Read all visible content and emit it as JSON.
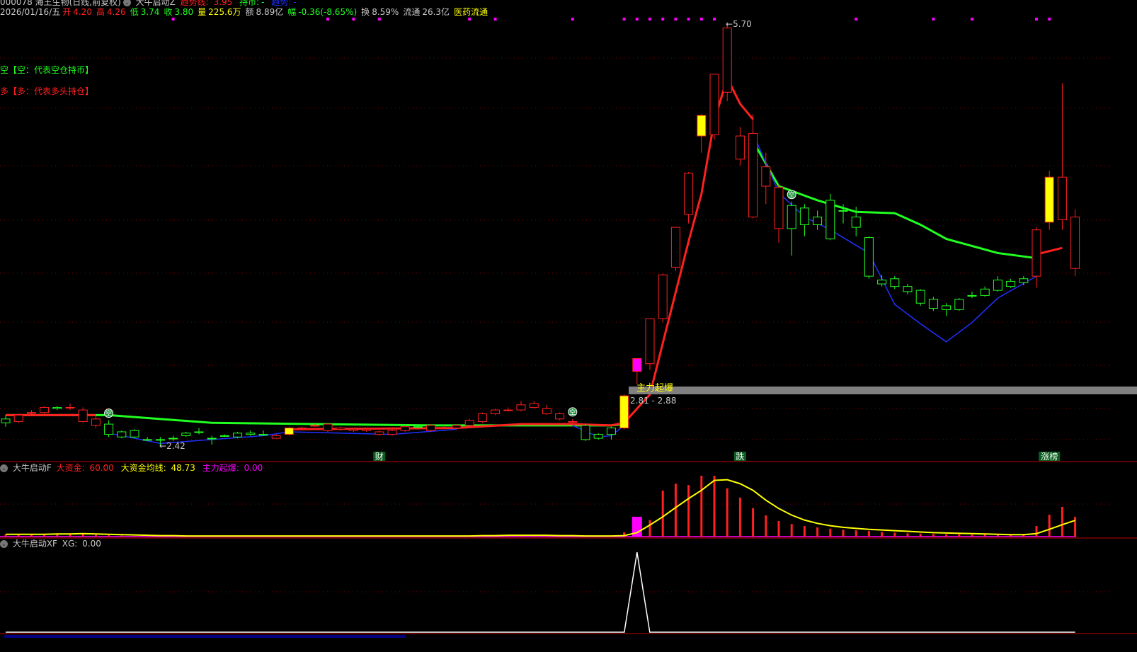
{
  "header": {
    "stock": "000078 海王生物(日线,前复权)",
    "indicator": "大牛启动Z",
    "trend_line_label": "趋势线:",
    "trend_line_value": "3.95",
    "hold_label": "持币:",
    "hold_value": "-",
    "trend_label": "趋势:",
    "trend_value": "-",
    "date": "2026/01/16/五",
    "open_label": "开",
    "open": "4.20",
    "high_label": "高",
    "high": "4.26",
    "low_label": "低",
    "low": "3.74",
    "close_label": "收",
    "close": "3.80",
    "vol_label": "量",
    "vol": "225.6万",
    "amount_label": "额",
    "amount": "8.89亿",
    "change_label": "幅",
    "change": "-0.36(-8.65%)",
    "turnover_label": "换",
    "turnover": "8.59%",
    "float_label": "流通",
    "float": "26.3亿",
    "sector": "医药流通"
  },
  "legend": {
    "empty": "空【空：代表空仓持币】",
    "long": "多【多：代表多头持仓】"
  },
  "annotations": {
    "low_mark": "2.42",
    "high_mark": "5.70",
    "zone_title": "主力起爆",
    "zone_range": "2.81 - 2.88",
    "empty_badge": "空",
    "events": [
      {
        "index": 29,
        "text": "财"
      },
      {
        "index": 57,
        "text": "跌"
      },
      {
        "index": 81,
        "text": "涨榜"
      }
    ]
  },
  "panel2": {
    "name": "大牛启动F",
    "big_money_label": "大资金:",
    "big_money": "60.00",
    "avg_label": "大资金均线:",
    "avg": "48.73",
    "burst_label": "主力起爆:",
    "burst": "0.00"
  },
  "panel3": {
    "name": "大牛启动XF",
    "xg_label": "XG:",
    "xg": "0.00"
  },
  "colors": {
    "up": "#ff2020",
    "down": "#20ff20",
    "yellow": "#ffff00",
    "magenta": "#ff00ff",
    "blue": "#2030ff",
    "grid": "#8b0000"
  },
  "chart_data": {
    "type": "candlestick",
    "price_range": [
      2.42,
      5.7
    ],
    "candles": [
      [
        2.63,
        2.6,
        2.66,
        2.57,
        "d"
      ],
      [
        2.61,
        2.66,
        2.67,
        2.6,
        "u"
      ],
      [
        2.68,
        2.68,
        2.7,
        2.66,
        "u"
      ],
      [
        2.68,
        2.72,
        2.73,
        2.67,
        "u"
      ],
      [
        2.72,
        2.71,
        2.73,
        2.7,
        "d"
      ],
      [
        2.72,
        2.72,
        2.75,
        2.7,
        "u"
      ],
      [
        2.61,
        2.7,
        2.72,
        2.6,
        "u"
      ],
      [
        2.58,
        2.63,
        2.65,
        2.56,
        "u"
      ],
      [
        2.59,
        2.51,
        2.62,
        2.49,
        "d"
      ],
      [
        2.53,
        2.49,
        2.54,
        2.48,
        "d"
      ],
      [
        2.54,
        2.49,
        2.55,
        2.48,
        "d"
      ],
      [
        2.47,
        2.47,
        2.49,
        2.46,
        "d"
      ],
      [
        2.47,
        2.47,
        2.49,
        2.42,
        "d"
      ],
      [
        2.48,
        2.48,
        2.5,
        2.46,
        "d"
      ],
      [
        2.52,
        2.5,
        2.53,
        2.49,
        "d"
      ],
      [
        2.53,
        2.53,
        2.56,
        2.51,
        "d"
      ],
      [
        2.48,
        2.48,
        2.5,
        2.43,
        "d"
      ],
      [
        2.5,
        2.5,
        2.51,
        2.49,
        "d"
      ],
      [
        2.52,
        2.49,
        2.53,
        2.48,
        "d"
      ],
      [
        2.52,
        2.51,
        2.54,
        2.5,
        "d"
      ],
      [
        2.51,
        2.51,
        2.54,
        2.5,
        "d"
      ],
      [
        2.48,
        2.5,
        2.51,
        2.48,
        "u"
      ],
      [
        2.51,
        2.56,
        2.57,
        2.5,
        "y"
      ],
      [
        2.56,
        2.56,
        2.57,
        2.55,
        "u"
      ],
      [
        2.58,
        2.58,
        2.59,
        2.57,
        "u"
      ],
      [
        2.54,
        2.59,
        2.6,
        2.53,
        "u"
      ],
      [
        2.55,
        2.56,
        2.57,
        2.54,
        "u"
      ],
      [
        2.54,
        2.55,
        2.56,
        2.53,
        "u"
      ],
      [
        2.54,
        2.55,
        2.56,
        2.53,
        "u"
      ],
      [
        2.51,
        2.53,
        2.54,
        2.5,
        "u"
      ],
      [
        2.51,
        2.54,
        2.55,
        2.5,
        "u"
      ],
      [
        2.54,
        2.57,
        2.58,
        2.53,
        "u"
      ],
      [
        2.57,
        2.57,
        2.58,
        2.56,
        "d"
      ],
      [
        2.54,
        2.58,
        2.59,
        2.53,
        "u"
      ],
      [
        2.56,
        2.56,
        2.58,
        2.55,
        "u"
      ],
      [
        2.56,
        2.58,
        2.59,
        2.55,
        "u"
      ],
      [
        2.58,
        2.62,
        2.63,
        2.57,
        "u"
      ],
      [
        2.61,
        2.67,
        2.68,
        2.6,
        "u"
      ],
      [
        2.67,
        2.7,
        2.71,
        2.66,
        "u"
      ],
      [
        2.7,
        2.7,
        2.72,
        2.69,
        "u"
      ],
      [
        2.7,
        2.74,
        2.77,
        2.69,
        "u"
      ],
      [
        2.72,
        2.75,
        2.77,
        2.71,
        "u"
      ],
      [
        2.67,
        2.71,
        2.74,
        2.66,
        "u"
      ],
      [
        2.63,
        2.67,
        2.68,
        2.62,
        "u"
      ],
      [
        2.61,
        2.61,
        2.63,
        2.6,
        "u"
      ],
      [
        2.58,
        2.47,
        2.59,
        2.46,
        "d"
      ],
      [
        2.51,
        2.48,
        2.52,
        2.47,
        "d"
      ],
      [
        2.56,
        2.51,
        2.57,
        2.47,
        "d"
      ],
      [
        2.56,
        2.81,
        2.82,
        2.55,
        "y"
      ],
      [
        3.0,
        3.1,
        3.1,
        2.9,
        "m"
      ],
      [
        3.06,
        3.41,
        3.41,
        3.01,
        "u"
      ],
      [
        3.41,
        3.75,
        3.76,
        3.38,
        "u"
      ],
      [
        3.81,
        4.12,
        4.12,
        3.78,
        "u"
      ],
      [
        4.22,
        4.54,
        4.55,
        4.15,
        "u"
      ],
      [
        4.83,
        4.99,
        5.0,
        4.7,
        "y"
      ],
      [
        4.84,
        5.31,
        5.31,
        4.8,
        "u"
      ],
      [
        5.17,
        5.67,
        5.7,
        5.1,
        "u"
      ],
      [
        4.65,
        4.83,
        4.9,
        4.6,
        "u"
      ],
      [
        4.2,
        4.85,
        5.0,
        4.19,
        "u"
      ],
      [
        4.44,
        4.59,
        4.7,
        4.3,
        "u"
      ],
      [
        4.11,
        4.43,
        4.45,
        4.0,
        "u"
      ],
      [
        4.29,
        4.11,
        4.32,
        3.9,
        "d"
      ],
      [
        4.27,
        4.14,
        4.3,
        4.05,
        "d"
      ],
      [
        4.2,
        4.14,
        4.25,
        4.1,
        "d"
      ],
      [
        4.33,
        4.03,
        4.38,
        4.02,
        "d"
      ],
      [
        4.25,
        4.25,
        4.3,
        4.15,
        "d"
      ],
      [
        4.2,
        4.12,
        4.28,
        4.05,
        "d"
      ],
      [
        4.04,
        3.74,
        4.05,
        3.72,
        "d"
      ],
      [
        3.71,
        3.68,
        3.75,
        3.66,
        "d"
      ],
      [
        3.72,
        3.66,
        3.74,
        3.64,
        "d"
      ],
      [
        3.66,
        3.62,
        3.68,
        3.6,
        "d"
      ],
      [
        3.63,
        3.53,
        3.64,
        3.51,
        "d"
      ],
      [
        3.56,
        3.49,
        3.58,
        3.47,
        "d"
      ],
      [
        3.51,
        3.48,
        3.53,
        3.43,
        "d"
      ],
      [
        3.56,
        3.48,
        3.57,
        3.47,
        "d"
      ],
      [
        3.59,
        3.59,
        3.62,
        3.57,
        "d"
      ],
      [
        3.64,
        3.59,
        3.66,
        3.58,
        "d"
      ],
      [
        3.71,
        3.63,
        3.74,
        3.62,
        "d"
      ],
      [
        3.7,
        3.66,
        3.72,
        3.65,
        "d"
      ],
      [
        3.72,
        3.69,
        3.74,
        3.67,
        "d"
      ],
      [
        3.74,
        4.1,
        4.12,
        3.65,
        "u"
      ],
      [
        4.16,
        4.51,
        4.56,
        4.1,
        "y"
      ],
      [
        4.18,
        4.51,
        5.24,
        4.1,
        "u"
      ],
      [
        4.2,
        3.8,
        4.26,
        3.74,
        "u"
      ]
    ],
    "lines": [
      {
        "name": "hold-line",
        "color": "#20ff20",
        "segments": [
          [
            [
              0,
              2.66
            ],
            [
              8,
              2.66
            ],
            [
              16,
              2.6
            ],
            [
              33,
              2.58
            ],
            [
              47,
              2.58
            ],
            [
              48,
              2.59
            ]
          ],
          [
            [
              58,
              4.79
            ],
            [
              60,
              4.44
            ],
            [
              63,
              4.33
            ],
            [
              66,
              4.24
            ],
            [
              69,
              4.23
            ],
            [
              71,
              4.14
            ],
            [
              73,
              4.03
            ],
            [
              77,
              3.92
            ],
            [
              80,
              3.88
            ]
          ]
        ]
      },
      {
        "name": "long-line",
        "color": "#ff2020",
        "segments": [
          [
            [
              0,
              2.66
            ],
            [
              7,
              2.66
            ]
          ],
          [
            [
              22,
              2.55
            ],
            [
              35,
              2.56
            ],
            [
              40,
              2.59
            ],
            [
              44,
              2.59
            ],
            [
              47,
              2.58
            ],
            [
              48,
              2.6
            ],
            [
              50,
              2.82
            ],
            [
              51,
              3.22
            ],
            [
              53,
              4.01
            ],
            [
              54,
              4.38
            ],
            [
              55,
              4.95
            ],
            [
              56,
              5.28
            ],
            [
              57,
              5.08
            ],
            [
              58,
              4.96
            ]
          ],
          [
            [
              80,
              3.91
            ],
            [
              82,
              3.96
            ]
          ]
        ]
      },
      {
        "name": "trend-line",
        "color": "#2030ff",
        "segments": [
          [
            [
              8,
              2.52
            ],
            [
              12,
              2.44
            ],
            [
              20,
              2.5
            ],
            [
              22,
              2.53
            ],
            [
              30,
              2.51
            ],
            [
              35,
              2.55
            ]
          ],
          [
            [
              44,
              2.58
            ],
            [
              46,
              2.49
            ],
            [
              47,
              2.5
            ],
            [
              48,
              2.58
            ]
          ],
          [
            [
              58,
              4.85
            ],
            [
              60,
              4.39
            ],
            [
              62,
              4.2
            ],
            [
              64,
              4.1
            ],
            [
              67,
              3.92
            ],
            [
              69,
              3.52
            ],
            [
              71,
              3.37
            ],
            [
              73,
              3.23
            ],
            [
              75,
              3.38
            ],
            [
              77,
              3.57
            ],
            [
              80,
              3.74
            ]
          ]
        ]
      }
    ],
    "empty_badges": [
      8,
      44,
      61
    ],
    "signal_dots": [
      13,
      25,
      27,
      29,
      36,
      38,
      44,
      48,
      49,
      50,
      51,
      52,
      53,
      54,
      55,
      66,
      72,
      75,
      80,
      81
    ],
    "big_money": [
      6,
      5,
      5,
      6,
      6,
      7,
      8,
      5,
      4,
      3,
      2,
      1,
      1,
      1,
      1,
      1,
      1,
      1,
      1,
      1,
      1,
      1,
      1,
      1,
      1,
      1,
      1,
      1,
      1,
      1,
      1,
      1,
      1,
      1,
      1,
      2,
      3,
      4,
      4,
      5,
      4,
      4,
      3,
      3,
      2,
      2,
      2,
      2,
      13,
      0,
      50,
      139,
      160,
      156,
      184,
      184,
      146,
      118,
      86,
      64,
      47,
      38,
      32,
      28,
      24,
      21,
      19,
      17,
      14,
      12,
      10,
      9,
      8,
      7,
      7,
      6,
      6,
      5,
      5,
      5,
      32,
      66,
      90,
      60
    ],
    "big_money_avg": [
      7,
      7,
      7,
      7,
      8,
      8,
      9,
      8,
      7,
      6,
      5,
      4,
      3,
      3,
      2,
      2,
      2,
      2,
      2,
      2,
      2,
      2,
      2,
      2,
      2,
      2,
      2,
      2,
      2,
      2,
      2,
      2,
      2,
      2,
      2,
      2,
      2,
      3,
      3,
      4,
      4,
      4,
      4,
      3,
      3,
      2,
      2,
      2,
      3,
      12,
      35,
      60,
      88,
      115,
      140,
      170,
      172,
      160,
      140,
      110,
      85,
      65,
      50,
      40,
      33,
      28,
      25,
      22,
      20,
      18,
      16,
      14,
      12,
      11,
      10,
      9,
      8,
      7,
      6,
      6,
      9,
      22,
      36,
      49
    ],
    "burst": {
      "index": 49,
      "value": 60
    },
    "xg": {
      "index": 49,
      "value": 1
    }
  }
}
